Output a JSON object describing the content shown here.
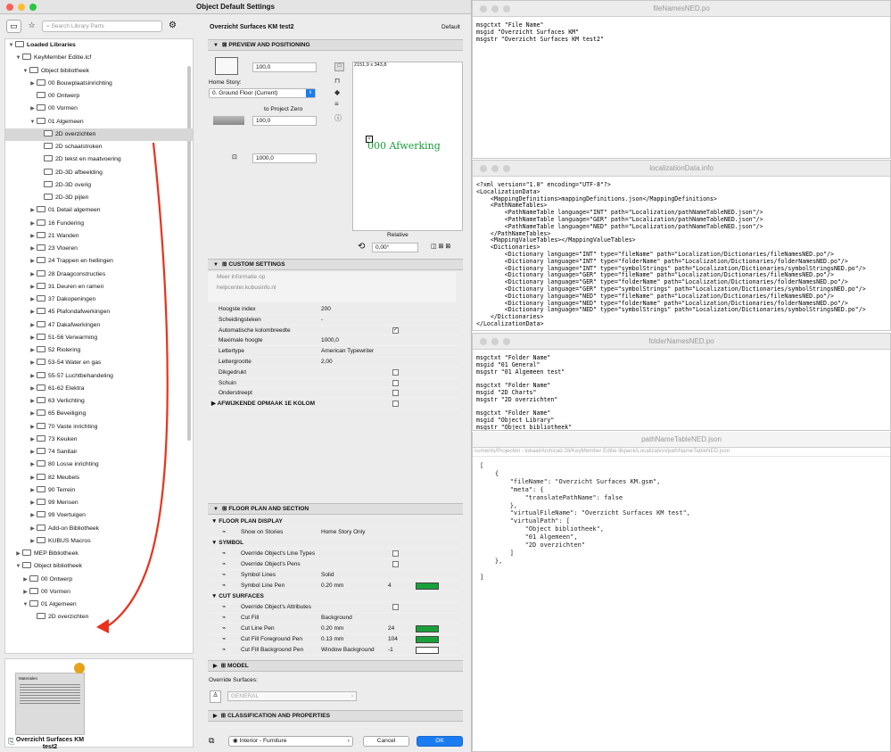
{
  "main_window": {
    "title": "Object Default Settings"
  },
  "library": {
    "search_placeholder": "Search Library Parts",
    "tree": [
      {
        "label": "Loaded Libraries",
        "bold": true
      },
      {
        "label": "KeyMember Editie.lcf"
      },
      {
        "label": "Object bibliotheek"
      },
      {
        "label": "00 Bouwplaatsinrichting"
      },
      {
        "label": "00 Ontwerp"
      },
      {
        "label": "00 Vormen"
      },
      {
        "label": "01 Algemeen"
      },
      {
        "label": "2D overzichten",
        "selected": true
      },
      {
        "label": "2D schaalstroken"
      },
      {
        "label": "2D tekst en maatvoering"
      },
      {
        "label": "2D-3D afbeelding"
      },
      {
        "label": "2D-3D overig"
      },
      {
        "label": "2D-3D pijlen"
      },
      {
        "label": "01 Detail algemeen"
      },
      {
        "label": "16 Fundering"
      },
      {
        "label": "21 Wanden"
      },
      {
        "label": "23 Vloeren"
      },
      {
        "label": "24 Trappen en hellingen"
      },
      {
        "label": "28 Draagconstructies"
      },
      {
        "label": "31 Deuren en ramen"
      },
      {
        "label": "37 Dakopeningen"
      },
      {
        "label": "45 Plafondafwerkingen"
      },
      {
        "label": "47 Dakafwerkingen"
      },
      {
        "label": "51-56 Verwarming"
      },
      {
        "label": "52 Riolering"
      },
      {
        "label": "53-54 Water en gas"
      },
      {
        "label": "55-57 Luchtbehandeling"
      },
      {
        "label": "61-62 Elektra"
      },
      {
        "label": "63 Verlichting"
      },
      {
        "label": "65 Beveiliging"
      },
      {
        "label": "70 Vaste inrichting"
      },
      {
        "label": "73 Keuken"
      },
      {
        "label": "74 Sanitair"
      },
      {
        "label": "80 Losse inrichting"
      },
      {
        "label": "82 Meubels"
      },
      {
        "label": "90 Terrein"
      },
      {
        "label": "99 Mensen"
      },
      {
        "label": "99 Voertuigen"
      },
      {
        "label": "Add-on Bibliotheek"
      },
      {
        "label": "KUBUS Macros"
      },
      {
        "label": "MEP Bibliotheek"
      },
      {
        "label": "Object bibliotheek"
      },
      {
        "label": "00 Ontwerp"
      },
      {
        "label": "00 Vormen"
      },
      {
        "label": "01 Algemeen"
      },
      {
        "label": "2D overzichten"
      }
    ],
    "preview_name": "Overzicht Surfaces KM test2",
    "preview_sheet_title": "Materialen"
  },
  "header": {
    "object_name": "Overzicht Surfaces KM test2",
    "default_label": "Default"
  },
  "preview": {
    "section": "PREVIEW AND POSITIONING",
    "height": "100,0",
    "home_story_label": "Home Story:",
    "home_story": "0. Ground Floor (Current)",
    "to_project_zero": "to Project Zero",
    "elevation": "100,0",
    "width": "1000,0",
    "canvas_size": "2151,9 x 343,8",
    "canvas_text": "000 Afwerking",
    "relative": "Relative",
    "angle": "0,00°"
  },
  "custom": {
    "section": "CUSTOM SETTINGS",
    "info": "Meer informatie op",
    "link": "helpcenter.kubusinfo.nl",
    "rows": [
      {
        "label": "Hoogste index",
        "value": "200"
      },
      {
        "label": "Scheidingsteken",
        "value": "-"
      },
      {
        "label": "Automatische kolombreedte",
        "value": "",
        "check": true
      },
      {
        "label": "Maximale hoogte",
        "value": "1000,0"
      },
      {
        "label": "Lettertype",
        "value": "American Typewriter"
      },
      {
        "label": "Lettergrootte",
        "value": "2,00"
      },
      {
        "label": "Dikgedrukt",
        "value": "",
        "check": false
      },
      {
        "label": "Schuin",
        "value": "",
        "check": false
      },
      {
        "label": "Onderstreept",
        "value": "",
        "check": false
      },
      {
        "label": "AFWIJKENDE OPMAAK 1E KOLOM",
        "value": "",
        "check": false,
        "bold": true
      }
    ]
  },
  "floorplan": {
    "section": "FLOOR PLAN AND SECTION",
    "rows": [
      {
        "label": "FLOOR PLAN DISPLAY",
        "head": true
      },
      {
        "label": "Show on Stories",
        "value": "Home Story Only"
      },
      {
        "label": "SYMBOL",
        "head": true
      },
      {
        "label": "Override Object's Line Types",
        "check": false
      },
      {
        "label": "Override Object's Pens",
        "check": false
      },
      {
        "label": "Symbol Lines",
        "value": "Solid"
      },
      {
        "label": "Symbol Line Pen",
        "value": "0.20 mm",
        "num": "4"
      },
      {
        "label": "CUT SURFACES",
        "head": true
      },
      {
        "label": "Override Object's Attributes",
        "check": false
      },
      {
        "label": "Cut Fill",
        "value": "Background"
      },
      {
        "label": "Cut Line Pen",
        "value": "0.20 mm",
        "num": "24"
      },
      {
        "label": "Cut Fill Foreground Pen",
        "value": "0.13 mm",
        "num": "104"
      },
      {
        "label": "Cut Fill Background Pen",
        "value": "Window Background",
        "num": "-1"
      }
    ]
  },
  "model": {
    "section": "MODEL",
    "override": "Override Surfaces:",
    "general": "GENERAL"
  },
  "classification": {
    "section": "CLASSIFICATION AND PROPERTIES"
  },
  "footer": {
    "layer": "Interior - Furniture",
    "cancel": "Cancel",
    "ok": "OK"
  },
  "editors": {
    "file1": {
      "title": "fileNamesNED.po",
      "lines": [
        "msgctxt \"File Name\"",
        "msgid \"Overzicht Surfaces KM\"",
        "msgstr \"Overzicht Surfaces KM test2\""
      ]
    },
    "file2": {
      "title": "localizationData.info",
      "lines": [
        "<?xml version=\"1.0\" encoding=\"UTF-8\"?>",
        "<LocalizationData>",
        "    <MappingDefinitions>mappingDefinitions.json</MappingDefinitions>",
        "    <PathNameTables>",
        "        <PathNameTable language=\"INT\" path=\"Localization/pathNameTableNED.json\"/>",
        "        <PathNameTable language=\"GER\" path=\"Localization/pathNameTableNED.json\"/>",
        "        <PathNameTable language=\"NED\" path=\"Localization/pathNameTableNED.json\"/>",
        "    </PathNameTables>",
        "    <MappingValueTables></MappingValueTables>",
        "    <Dictionaries>",
        "        <Dictionary language=\"INT\" type=\"fileName\" path=\"Localization/Dictionaries/fileNamesNED.po\"/>",
        "        <Dictionary language=\"INT\" type=\"folderName\" path=\"Localization/Dictionaries/folderNamesNED.po\"/>",
        "        <Dictionary language=\"INT\" type=\"symbolStrings\" path=\"Localization/Dictionaries/symbolStringsNED.po\"/>",
        "        <Dictionary language=\"GER\" type=\"fileName\" path=\"Localization/Dictionaries/fileNamesNED.po\"/>",
        "        <Dictionary language=\"GER\" type=\"folderName\" path=\"Localization/Dictionaries/folderNamesNED.po\"/>",
        "        <Dictionary language=\"GER\" type=\"symbolStrings\" path=\"Localization/Dictionaries/symbolStringsNED.po\"/>",
        "        <Dictionary language=\"NED\" type=\"fileName\" path=\"Localization/Dictionaries/fileNamesNED.po\"/>",
        "        <Dictionary language=\"NED\" type=\"folderName\" path=\"Localization/Dictionaries/folderNamesNED.po\"/>",
        "        <Dictionary language=\"NED\" type=\"symbolStrings\" path=\"Localization/Dictionaries/symbolStringsNED.po\"/>",
        "    </Dictionaries>",
        "</LocalizationData>"
      ]
    },
    "file3": {
      "title": "folderNamesNED.po",
      "lines": [
        "msgctxt \"Folder Name\"",
        "msgid \"01 General\"",
        "msgstr \"01 Algemeen test\"",
        "",
        "msgctxt \"Folder Name\"",
        "msgid \"2D Charts\"",
        "msgstr \"2D overzichten\"",
        "",
        "msgctxt \"Folder Name\"",
        "msgid \"Object Library\"",
        "msgstr \"Object bibliotheek\""
      ]
    },
    "file4": {
      "title": "pathNameTableNED.json",
      "path": "cuments/Projecten - lokaal/Archicad 28/KeyMember Editie libpack/Localization/pathNameTableNED.json",
      "lines": [
        "[",
        "    {",
        "        \"fileName\": \"Overzicht Surfaces KM.gsm\",",
        "        \"meta\": {",
        "            \"translatePathName\": false",
        "        },",
        "        \"virtualFileName\": \"Overzicht Surfaces KM test\",",
        "        \"virtualPath\": [",
        "            \"Object bibliotheek\",",
        "            \"01 Algemeen\",",
        "            \"2D overzichten\"",
        "        ]",
        "    },",
        "",
        "]"
      ]
    }
  },
  "colors": {
    "accent": "#1a7cf0",
    "arrow": "#e8321c",
    "canvas_text": "#1a9a3a",
    "pen_green": "#1aa03a"
  }
}
